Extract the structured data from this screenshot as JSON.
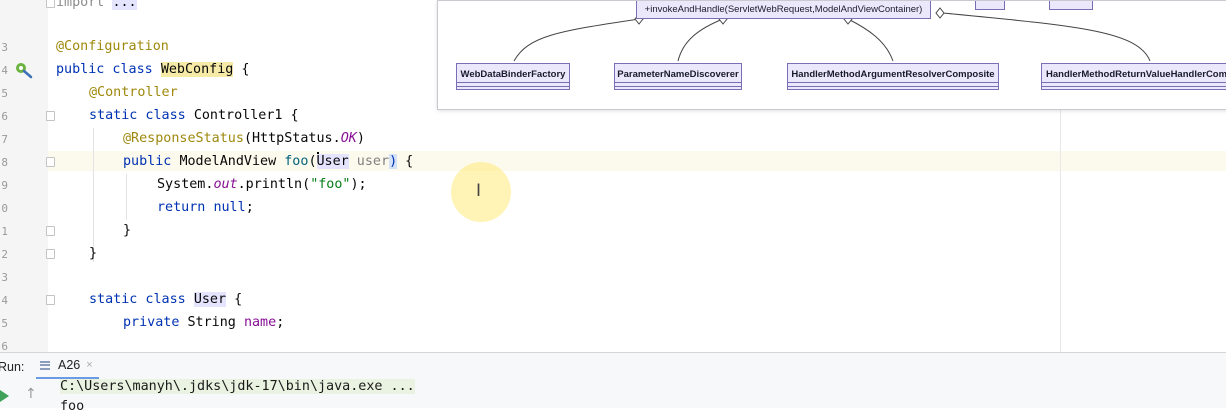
{
  "editor": {
    "line_numbers": [
      "",
      "3",
      "4",
      "5",
      "6",
      "7",
      "8",
      "9",
      "0",
      "1",
      "2",
      "3",
      "4",
      "5",
      "6"
    ],
    "lines": {
      "import_kw": "import",
      "import_dots": "...",
      "config_annotation": "@Configuration",
      "class_decl_prefix": "public class ",
      "class_name": "WebConfig",
      "class_decl_suffix": " {",
      "controller_annotation": "@Controller",
      "controller_decl_kw": "static class ",
      "controller_decl_name": "Controller1 {",
      "response_status_annotation": "@ResponseStatus",
      "response_status_args_open": "(HttpStatus.",
      "response_status_value": "OK",
      "response_status_args_close": ")",
      "method_kw": "public ",
      "method_type": "ModelAndView ",
      "method_name": "foo",
      "method_paren_open": "(",
      "method_param_type": "User",
      "method_param_name": " user",
      "method_paren_close": ")",
      "method_brace": " {",
      "println_prefix": "System.",
      "println_field": "out",
      "println_call": ".println(",
      "println_arg": "\"foo\"",
      "println_suffix": ");",
      "return_kw": "return ",
      "return_null": "null",
      "return_semi": ";",
      "close_brace_method": "}",
      "close_brace_class": "}",
      "user_decl_kw": "static class ",
      "user_decl_name": "User",
      "user_decl_suffix": " {",
      "field_kw": "private ",
      "field_type": "String ",
      "field_name": "name",
      "field_semi": ";"
    }
  },
  "diagram": {
    "method_signature": "+invokeAndHandle(ServletWebRequest,ModelAndViewContainer)",
    "classes": [
      "WebDataBinderFactory",
      "ParameterNameDiscoverer",
      "HandlerMethodArgumentResolverComposite",
      "HandlerMethodReturnValueHandlerComposite"
    ]
  },
  "run_panel": {
    "label": "Run:",
    "tab_label": "A26",
    "tab_close": "×",
    "console_command": "C:\\Users\\manyh\\.jdks\\jdk-17\\bin\\java.exe ...",
    "console_output": "foo"
  },
  "colors": {
    "keyword": "#0033b3",
    "annotation": "#9e880d",
    "string": "#067d17",
    "static_field": "#871094",
    "uml_fill": "#ece8fb",
    "run_icon": "#3fa15a"
  },
  "icons": [
    "spring-bean-icon",
    "fold-marker-icon",
    "run-icon",
    "scroll-up-icon",
    "text-cursor-icon"
  ]
}
